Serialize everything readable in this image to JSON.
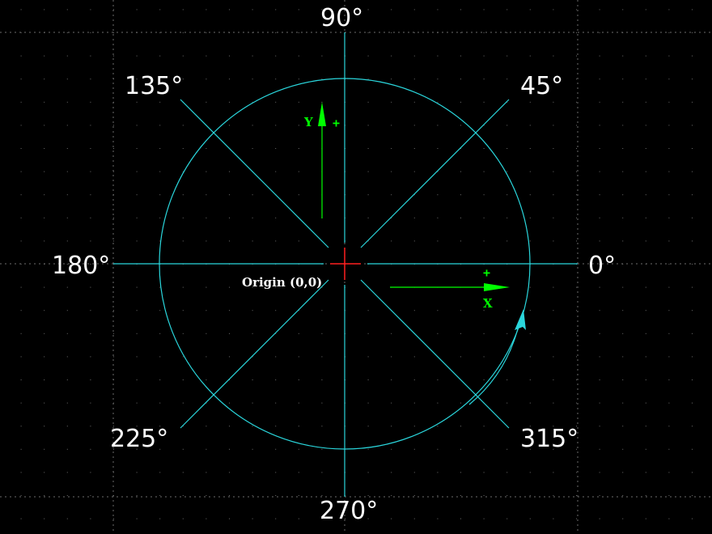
{
  "colors": {
    "background": "#000000",
    "grid": "#6b6b6b",
    "crosshair": "#8fa3a8",
    "circle": "#2ad6dc",
    "spokes": "#2ad6dc",
    "axes_ucs": "#00ff00",
    "origin_marker": "#ff0000",
    "direction_arrow": "#2ad6dc",
    "text": "#ffffff"
  },
  "angles": {
    "deg_0": "0°",
    "deg_45": "45°",
    "deg_90": "90°",
    "deg_135": "135°",
    "deg_180": "180°",
    "deg_225": "225°",
    "deg_270": "270°",
    "deg_315": "315°"
  },
  "origin_label": "Origin (0,0)",
  "ucs": {
    "x_label": "X",
    "y_label": "Y",
    "x_plus": "+",
    "y_plus": "+"
  },
  "icons": {
    "rotation_arrow": "counterclockwise-arrow-icon",
    "origin_marker": "crosshair-icon"
  }
}
